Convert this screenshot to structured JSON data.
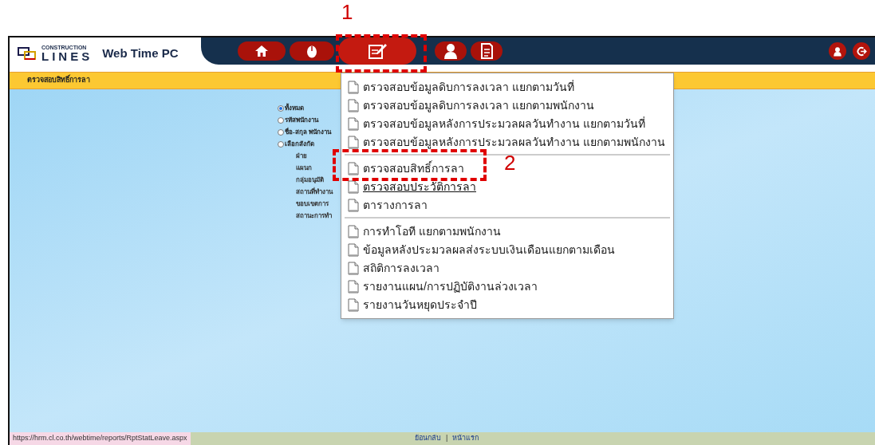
{
  "annotations": [
    {
      "label": "1"
    },
    {
      "label": "2"
    }
  ],
  "header": {
    "brand_small": "CONSTRUCTION",
    "brand": "LINES",
    "app_title": "Web Time PC",
    "nav": [
      {
        "selected": false
      },
      {
        "selected": false
      },
      {
        "selected": true
      },
      {
        "selected": false
      },
      {
        "selected": false
      }
    ]
  },
  "page_title": "ตรวจสอบสิทธิ์การลา",
  "filter": {
    "options": [
      {
        "label": "ทั้งหมด",
        "selected": true
      },
      {
        "label": "รหัสพนักงาน",
        "selected": false
      },
      {
        "label": "ชื่อ-สกุล พนักงาน",
        "selected": false
      },
      {
        "label": "เลือกสังกัด",
        "selected": false
      }
    ],
    "sub_labels": [
      "ฝ่าย",
      "แผนก",
      "กลุ่มอนุมัติ",
      "สถานที่ทำงาน",
      "ขอบเขตการ",
      "สถานะการทำ"
    ]
  },
  "menu": {
    "groups": [
      {
        "items": [
          {
            "label": "ตรวจสอบข้อมูลดิบการลงเวลา แยกตามวันที่",
            "hovered": false
          },
          {
            "label": "ตรวจสอบข้อมูลดิบการลงเวลา แยกตามพนักงาน",
            "hovered": false
          },
          {
            "label": "ตรวจสอบข้อมูลหลังการประมวลผลวันทำงาน แยกตามวันที่",
            "hovered": false
          },
          {
            "label": "ตรวจสอบข้อมูลหลังการประมวลผลวันทำงาน แยกตามพนักงาน",
            "hovered": false
          }
        ]
      },
      {
        "items": [
          {
            "label": "ตรวจสอบสิทธิ์การลา",
            "hovered": false
          },
          {
            "label": "ตรวจสอบประวัติการลา",
            "hovered": true
          },
          {
            "label": "ตารางการลา",
            "hovered": false
          }
        ]
      },
      {
        "items": [
          {
            "label": "การทำโอที แยกตามพนักงาน",
            "hovered": false
          },
          {
            "label": "ข้อมูลหลังประมวลผลส่งระบบเงินเดือนแยกตามเดือน",
            "hovered": false
          },
          {
            "label": "สถิติการลงเวลา",
            "hovered": false
          },
          {
            "label": "รายงานแผน/การปฏิบัติงานล่วงเวลา",
            "hovered": false
          },
          {
            "label": "รายงานวันหยุดประจำปี",
            "hovered": false
          }
        ]
      }
    ]
  },
  "status_bar": {
    "url": "https://hrm.cl.co.th/webtime/reports/RptStatLeave.aspx",
    "links": [
      "ย้อนกลับ",
      "หน้าแรก"
    ],
    "separator": "|"
  }
}
